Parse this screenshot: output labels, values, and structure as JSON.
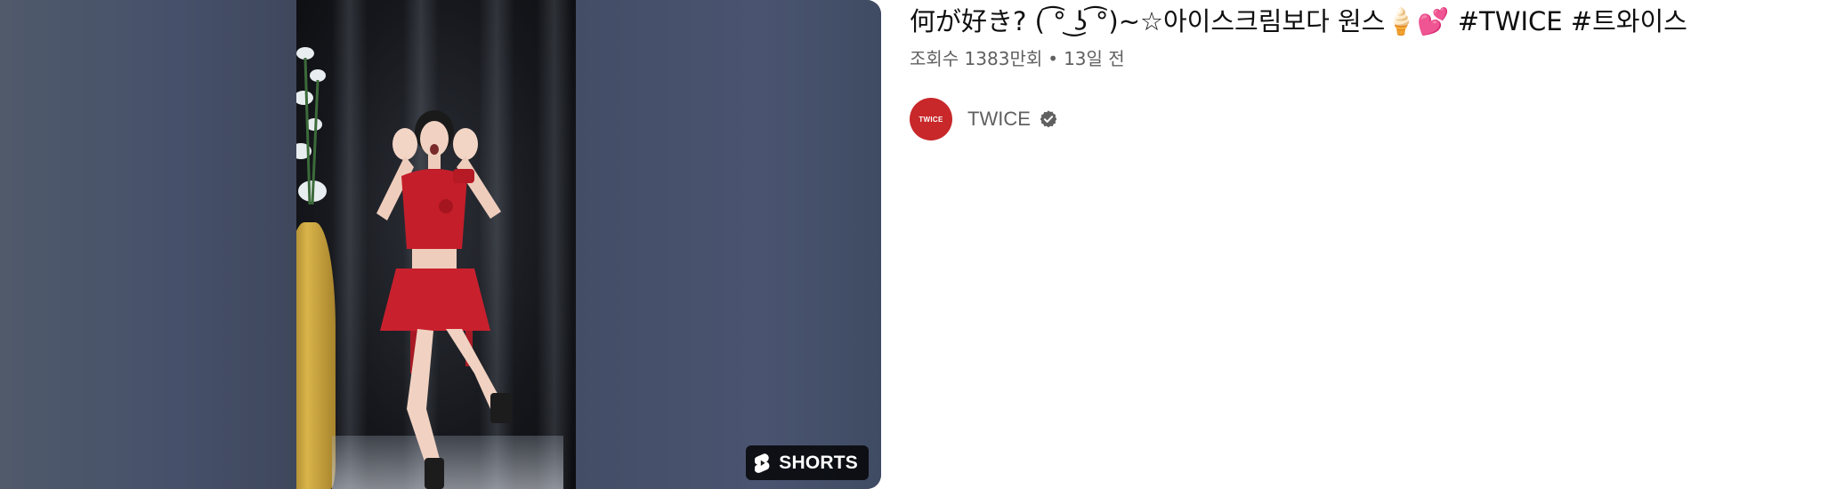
{
  "video": {
    "title": "何が好き? ( ͡° ͜ʖ ͡°)~☆아이스크림보다 원스🍦💕 #TWICE #트와이스",
    "views": "조회수 1383만회",
    "separator": "•",
    "age": "13일 전",
    "badge_label": "SHORTS"
  },
  "channel": {
    "name": "TWICE",
    "avatar_text": "TWICE",
    "verified": true
  },
  "colors": {
    "avatar_bg": "#c8282a",
    "badge_bg": "#000000cc",
    "meta_text": "#606060",
    "title_text": "#0f0f0f"
  },
  "icons": {
    "badge_icon": "shorts-icon",
    "verified_icon": "verified-badge-icon"
  }
}
